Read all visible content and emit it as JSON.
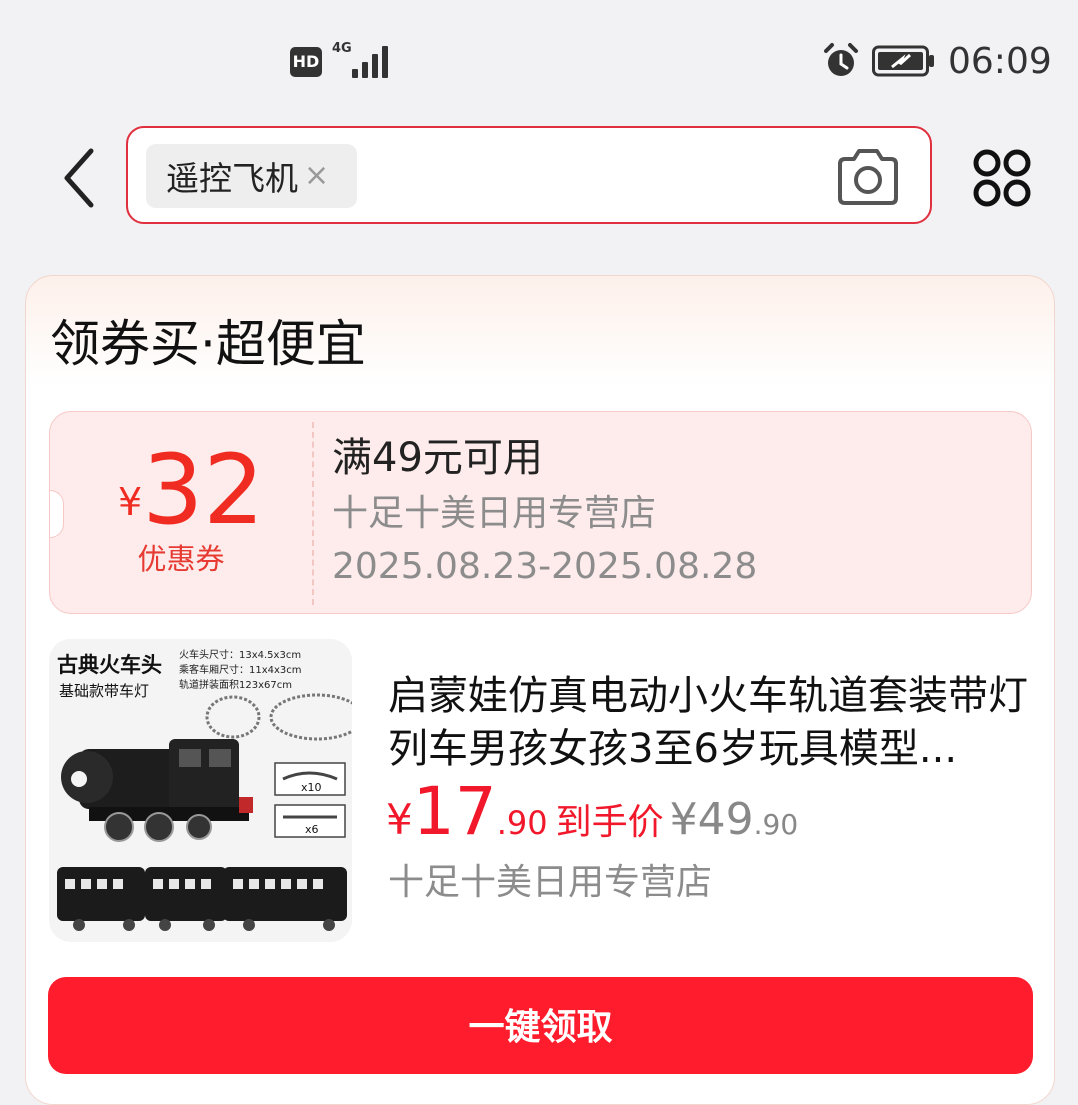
{
  "status_bar": {
    "hd": "HD",
    "network": "4G",
    "time": "06:09"
  },
  "header": {
    "search_chip": "遥控飞机",
    "chip_close": "×"
  },
  "card": {
    "title": "领券买·超便宜",
    "coupon": {
      "currency": "¥",
      "amount": "32",
      "label": "优惠券",
      "condition": "满49元可用",
      "store": "十足十美日用专营店",
      "period": "2025.08.23-2025.08.28"
    },
    "product": {
      "name": "启蒙娃仿真电动小火车轨道套装带灯列车男孩女孩3至6岁玩具模型...",
      "price_currency": "¥",
      "price_int": "17",
      "price_dec": ".90",
      "price_label": "到手价",
      "orig_currency": "¥",
      "orig_int": "49",
      "orig_dec": ".90",
      "store": "十足十美日用专营店",
      "image_text": {
        "title": "古典火车头",
        "subtitle": "基础款带车灯",
        "spec1": "火车头尺寸：13x4.5x3cm",
        "spec2": "乘客车厢尺寸：11x4x3cm",
        "spec3": "轨道拼装面积123x67cm",
        "track1_qty": "x10",
        "track2_qty": "x6"
      }
    },
    "button_label": "一键领取"
  },
  "colors": {
    "accent": "#ff1c2c",
    "coupon_red": "#f02b21",
    "muted": "#8c8c8c"
  }
}
